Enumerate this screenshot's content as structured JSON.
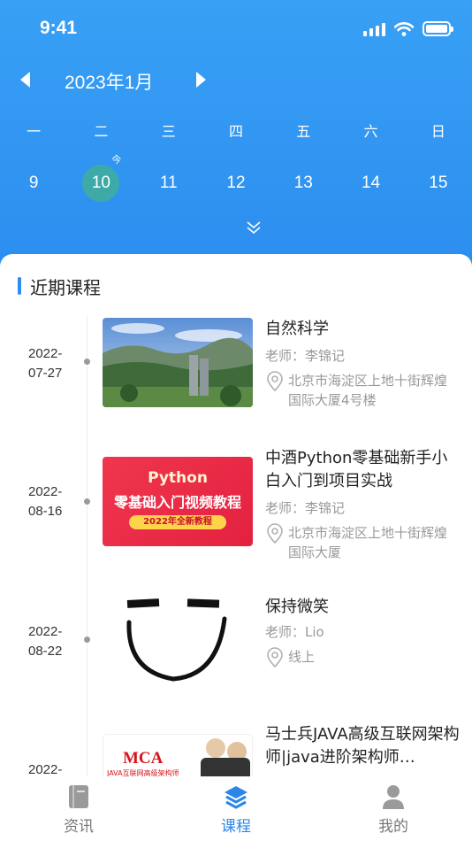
{
  "status_bar": {
    "time": "9:41"
  },
  "calendar": {
    "month": "2023年1月",
    "weekdays": [
      "一",
      "二",
      "三",
      "四",
      "五",
      "六",
      "日"
    ],
    "dates": [
      "9",
      "10",
      "11",
      "12",
      "13",
      "14",
      "15"
    ],
    "selected_index": 1,
    "today_label": "今",
    "colors": {
      "header": "#2c8eef",
      "selected": "#3eaaa8"
    }
  },
  "section": {
    "title": "近期课程"
  },
  "courses": [
    {
      "date_line1": "2022-",
      "date_line2": "07-27",
      "title": "自然科学",
      "teacher": "老师：李锦记",
      "address": "北京市海淀区上地十街辉煌国际大厦4号楼"
    },
    {
      "date_line1": "2022-",
      "date_line2": "08-16",
      "title": "中酒Python零基础新手小白入门到项目实战",
      "teacher": "老师：李锦记",
      "address": "北京市海淀区上地十街辉煌国际大厦",
      "thumb_lines": [
        "Python",
        "零基础入门视频教程",
        "2022年全新教程"
      ]
    },
    {
      "date_line1": "2022-",
      "date_line2": "08-22",
      "title": "保持微笑",
      "teacher": "老师：Lio",
      "address": "线上"
    },
    {
      "date_line1": "2022-",
      "date_line2": "",
      "title": "马士兵JAVA高级互联网架构师|java进阶架构师…",
      "thumb_lines": [
        "MCA",
        "JAVA互联网高级架构师"
      ]
    }
  ],
  "tabbar": {
    "items": [
      {
        "label": "资讯",
        "icon": "book-icon"
      },
      {
        "label": "课程",
        "icon": "layers-icon"
      },
      {
        "label": "我的",
        "icon": "person-icon"
      }
    ],
    "active_index": 1,
    "active_color": "#2c86e8"
  }
}
